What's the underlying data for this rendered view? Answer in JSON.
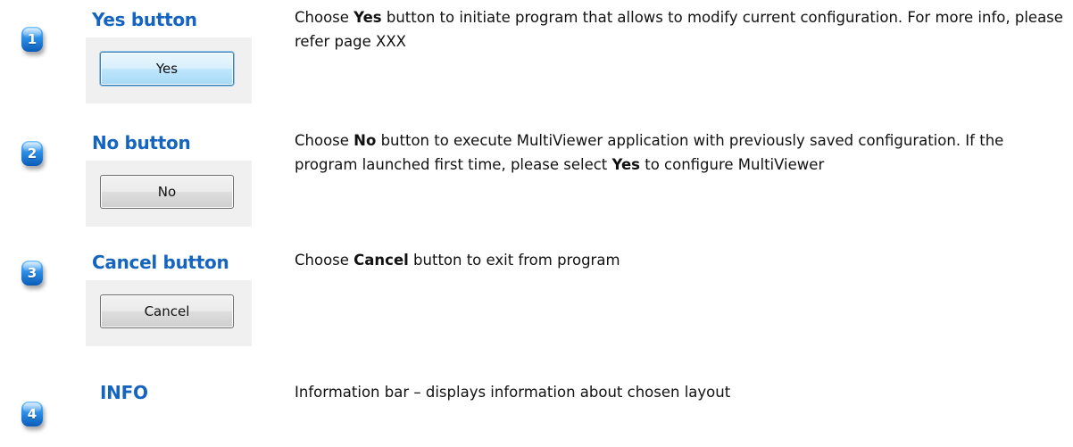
{
  "colors": {
    "badge": "#1e7ad8",
    "title": "#1565c0",
    "text": "#111111"
  },
  "items": [
    {
      "number": "1",
      "title": "Yes button",
      "button_label": "Yes",
      "desc_prefix": "Choose ",
      "desc_bold": "Yes",
      "desc_rest": " button to initiate program that allows to modify current configuration. For more info, please refer page XXX"
    },
    {
      "number": "2",
      "title": "No button",
      "button_label": "No",
      "desc_prefix": "Choose ",
      "desc_bold": "No",
      "desc_mid": " button to execute MultiViewer application with previously saved configuration. If the program launched first time, please select ",
      "desc_bold2": "Yes",
      "desc_rest": " to configure MultiViewer"
    },
    {
      "number": "3",
      "title": "Cancel button",
      "button_label": "Cancel",
      "desc_prefix": "Choose ",
      "desc_bold": "Cancel",
      "desc_rest": " button to exit from program"
    },
    {
      "number": "4",
      "title": "INFO",
      "desc": "Information bar – displays information about chosen layout"
    }
  ]
}
